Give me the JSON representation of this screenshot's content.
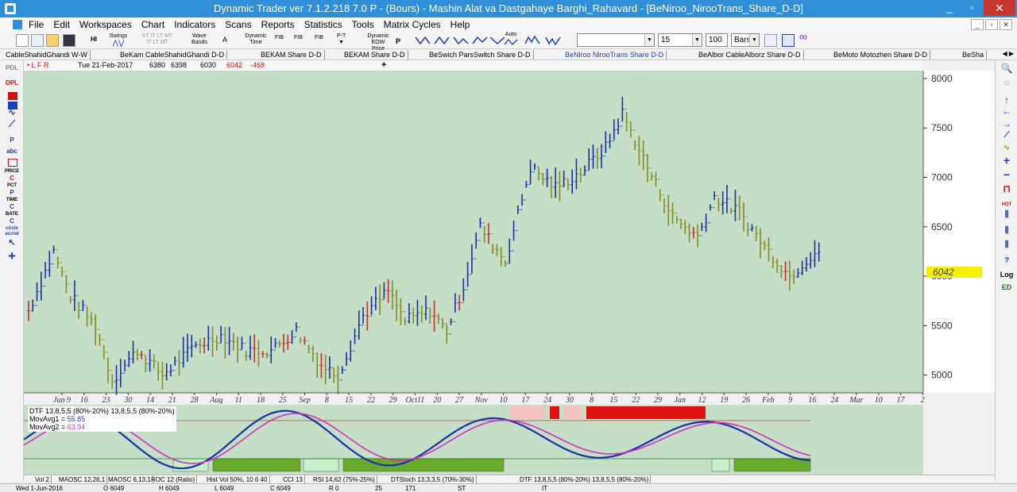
{
  "window": {
    "title": "Dynamic Trader ver 7.1.2.218 7.0 P - (Bours) - Mashin Alat va Dastgahaye Barghi_Rahavard - [BeNiroo_NirooTrans_Share_D-D]",
    "close_label": "✕",
    "minimize_label": "_",
    "restore_label": "▫"
  },
  "menu": [
    "File",
    "Edit",
    "Workspaces",
    "Chart",
    "Indicators",
    "Scans",
    "Reports",
    "Statistics",
    "Tools",
    "Matrix Cycles",
    "Help"
  ],
  "mdi_buttons": [
    "_",
    "▫",
    "✕"
  ],
  "toolbar": {
    "hi_label": "HI",
    "swings_label": "Swings",
    "swings_sub": "ST IT LT MT",
    "swings_sub2": "IT LT MT",
    "wave_label": "Wave",
    "bands_label": "Bands",
    "a_label": "A",
    "dyn_time_1": "Dynamic",
    "dyn_time_2": "Time",
    "fib_label": "FIB",
    "pt_label": "P-T",
    "dyn_price_1": "Dynamic EOW",
    "dyn_price_2": "Price",
    "p_label": "P",
    "auto_label": "Auto",
    "combo_1": "",
    "combo_2": "15",
    "combo_3": "100",
    "combo_4": "Bars"
  },
  "symbol_tabs": [
    {
      "label": "CableShahidGhandi  W-W",
      "active": false
    },
    {
      "label": "BeKam  CableShahidGhandi  D-D",
      "active": false
    },
    {
      "label": "BEKAM  Share  D-D",
      "active": false
    },
    {
      "label": "BEKAM  Share  D-D",
      "active": false
    },
    {
      "label": "BeSwich  ParsSwitch  Share  D-D",
      "active": false
    },
    {
      "label": "BeNiroo  NirooTrans  Share  D-D",
      "active": true
    },
    {
      "label": "BeAlbor  CableAlborz  Share  D-D",
      "active": false
    },
    {
      "label": "BeMoto  Motozhen  Share  D-D",
      "active": false
    },
    {
      "label": "BeSha",
      "active": false
    }
  ],
  "info": {
    "pdl": "PDL",
    "flags": "•  L  F  R",
    "date": "Tue 21-Feb-2017",
    "open": "6380",
    "high": "6398",
    "low": "6030",
    "close": "6042",
    "change": "-468",
    "cross": "+"
  },
  "left_tools": {
    "dpl": "DPL",
    "p": "P",
    "abc": "abc",
    "price": "PRICE",
    "c1": "C",
    "pct": "PCT",
    "p2": "P",
    "time": "TIME",
    "c2": "C",
    "bate": "BATE",
    "c3": "C",
    "circle": "circle",
    "accnd": "accnd",
    "plus": "+"
  },
  "right_tools": {
    "hot": "HOT",
    "q": "?",
    "log": "Log",
    "ed": "ED"
  },
  "chart_data": {
    "type": "bar",
    "y_ticks": [
      5000,
      5500,
      6000,
      6500,
      7000,
      7500,
      8000
    ],
    "y_tick_labels": [
      "5000",
      "5500",
      "6000",
      "6500",
      "7000",
      "7500",
      "8000"
    ],
    "ylim": [
      4820,
      8080
    ],
    "last_price_label": "6042",
    "last_price": 6042,
    "x_labels": [
      "Jun 9",
      "16",
      "23",
      "30",
      "14",
      "21",
      "28",
      "Aug",
      "11",
      "18",
      "25",
      "Sep",
      "8",
      "15",
      "22",
      "29",
      "Oct11",
      "20",
      "27",
      "Nov",
      "10",
      "17",
      "24",
      "30",
      "8",
      "15",
      "22",
      "29",
      "Jan",
      "12",
      "19",
      "26",
      "Feb",
      "9",
      "16",
      "24",
      "Mar",
      "10",
      "17",
      "2"
    ],
    "bar_count": 190,
    "colors": {
      "up": "#1a2fa8",
      "down": "#868a22",
      "flat": "#c03030",
      "label_bg": "#f5f000",
      "grid": "#c03030"
    },
    "indicator": {
      "legend_1": "DTF 13,8,5,5 (80%-20%) 13,8,5,5 (80%-20%)",
      "legend_2_label": "MovAvg1 = ",
      "legend_2_value": "55.85",
      "legend_3_label": "MovAvg2 = ",
      "legend_3_value": "63.94",
      "overbought": 80,
      "oversold": 20
    }
  },
  "indicator_tabs": [
    "Vol 2",
    "MAOSC 12,26,1",
    "MAOSC 6,13,1",
    "ROC 12 (Ratio)",
    "Hist Vol 50%, 10 6 40",
    "CCI 13",
    "RSI 14,62 (75%-25%)",
    "DTStoch 13,3,3,5 (70%-30%)",
    "DTF 13,8,5,5 (80%-20%) 13,8,5,5 (80%-20%)"
  ],
  "status": {
    "date": "Wed 1-Jun-2016",
    "o": "O 6049",
    "h": "H 6049",
    "l": "L 6049",
    "c": "C 6049",
    "r": "R 0",
    "n1": "25",
    "n2": "171",
    "st": "ST",
    "it": "IT"
  }
}
